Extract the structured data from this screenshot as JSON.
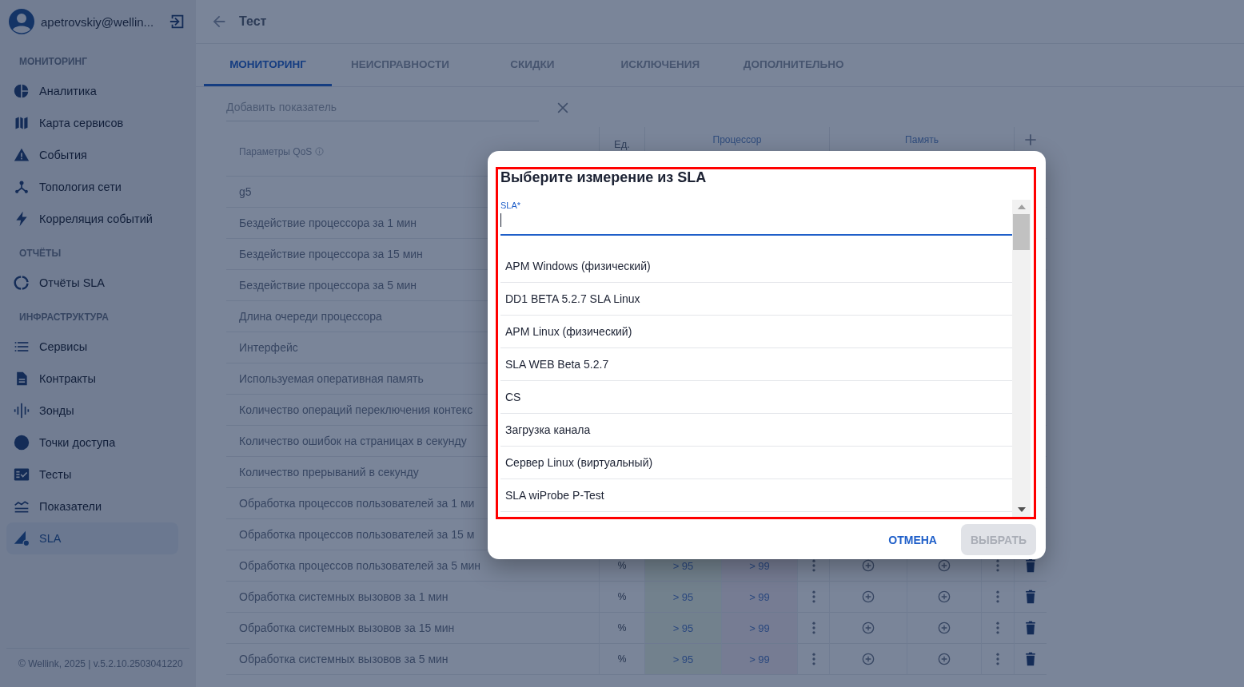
{
  "user": {
    "email": "apetrovskiy@wellin..."
  },
  "sidebar": {
    "sections": [
      {
        "title": "МОНИТОРИНГ",
        "items": [
          {
            "label": "Аналитика",
            "kind": "pie",
            "selected": false
          },
          {
            "label": "Карта сервисов",
            "kind": "map",
            "selected": false
          },
          {
            "label": "События",
            "kind": "warning",
            "selected": false
          },
          {
            "label": "Топология сети",
            "kind": "topology",
            "selected": false
          },
          {
            "label": "Корреляция событий",
            "kind": "bolt",
            "selected": false
          }
        ]
      },
      {
        "title": "ОТЧЁТЫ",
        "items": [
          {
            "label": "Отчёты SLA",
            "kind": "ring",
            "selected": false
          }
        ]
      },
      {
        "title": "ИНФРАСТРУКТУРА",
        "items": [
          {
            "label": "Сервисы",
            "kind": "list",
            "selected": false
          },
          {
            "label": "Контракты",
            "kind": "document",
            "selected": false
          },
          {
            "label": "Зонды",
            "kind": "probe",
            "selected": false
          },
          {
            "label": "Точки доступа",
            "kind": "dot",
            "selected": false
          },
          {
            "label": "Тесты",
            "kind": "tests",
            "selected": false
          },
          {
            "label": "Показатели",
            "kind": "metrics",
            "selected": false
          },
          {
            "label": "SLA",
            "kind": "sla",
            "selected": true
          }
        ]
      }
    ],
    "footer": "© Wellink, 2025 | v.5.2.10.2503041220"
  },
  "page": {
    "title": "Тест"
  },
  "tabs": [
    {
      "label": "МОНИТОРИНГ",
      "selected": true
    },
    {
      "label": "НЕИСПРАВНОСТИ",
      "selected": false
    },
    {
      "label": "СКИДКИ",
      "selected": false
    },
    {
      "label": "ИСКЛЮЧЕНИЯ",
      "selected": false
    },
    {
      "label": "ДОПОЛНИТЕЛЬНО",
      "selected": false
    }
  ],
  "add_field": {
    "placeholder": "Добавить показатель"
  },
  "table": {
    "columns": {
      "name": "Параметры QoS",
      "unit": "Ед.",
      "groups": [
        "Процессор",
        "Память"
      ]
    },
    "rows": [
      {
        "name": "g5"
      },
      {
        "name": "Бездействие процессора за 1 мин"
      },
      {
        "name": "Бездействие процессора за 15 мин"
      },
      {
        "name": "Бездействие процессора за 5 мин"
      },
      {
        "name": "Длина очереди процессора"
      },
      {
        "name": "Интерфейс"
      },
      {
        "name": "Используемая оперативная память"
      },
      {
        "name": "Количество операций переключения контекс"
      },
      {
        "name": "Количество ошибок на страницах в секунду"
      },
      {
        "name": "Количество прерываний в секунду"
      },
      {
        "name": "Обработка процессов пользователей за 1 ми"
      },
      {
        "name": "Обработка процессов пользователей за 15 м"
      },
      {
        "name": "Обработка процессов пользователей за 5 мин",
        "cells": {
          "unit": "%",
          "values": [
            "> 95",
            "> 99"
          ]
        }
      },
      {
        "name": "Обработка системных вызовов за 1 мин",
        "cells": {
          "unit": "%",
          "values": [
            "> 95",
            "> 99"
          ]
        }
      },
      {
        "name": "Обработка системных вызовов за 15 мин",
        "cells": {
          "unit": "%",
          "values": [
            "> 95",
            "> 99"
          ]
        }
      },
      {
        "name": "Обработка системных вызовов за 5 мин",
        "cells": {
          "unit": "%",
          "values": [
            "> 95",
            "> 99"
          ]
        }
      }
    ]
  },
  "dialog": {
    "title": "Выберите измерение из SLA",
    "highlighted": true,
    "field": {
      "label": "SLA*",
      "focused": true
    },
    "options": [
      "APM Windows (физический)",
      "DD1 BETA 5.2.7 SLA Linux",
      "APM Linux (физический)",
      "SLA WEB Beta 5.2.7",
      "CS",
      "Загрузка канала",
      "Сервер Linux (виртуальный)",
      "SLA wiProbe P-Test"
    ],
    "buttons": [
      {
        "label": "ОТМЕНА",
        "disabled": false
      },
      {
        "label": "ВЫБРАТЬ",
        "disabled": true
      }
    ]
  }
}
